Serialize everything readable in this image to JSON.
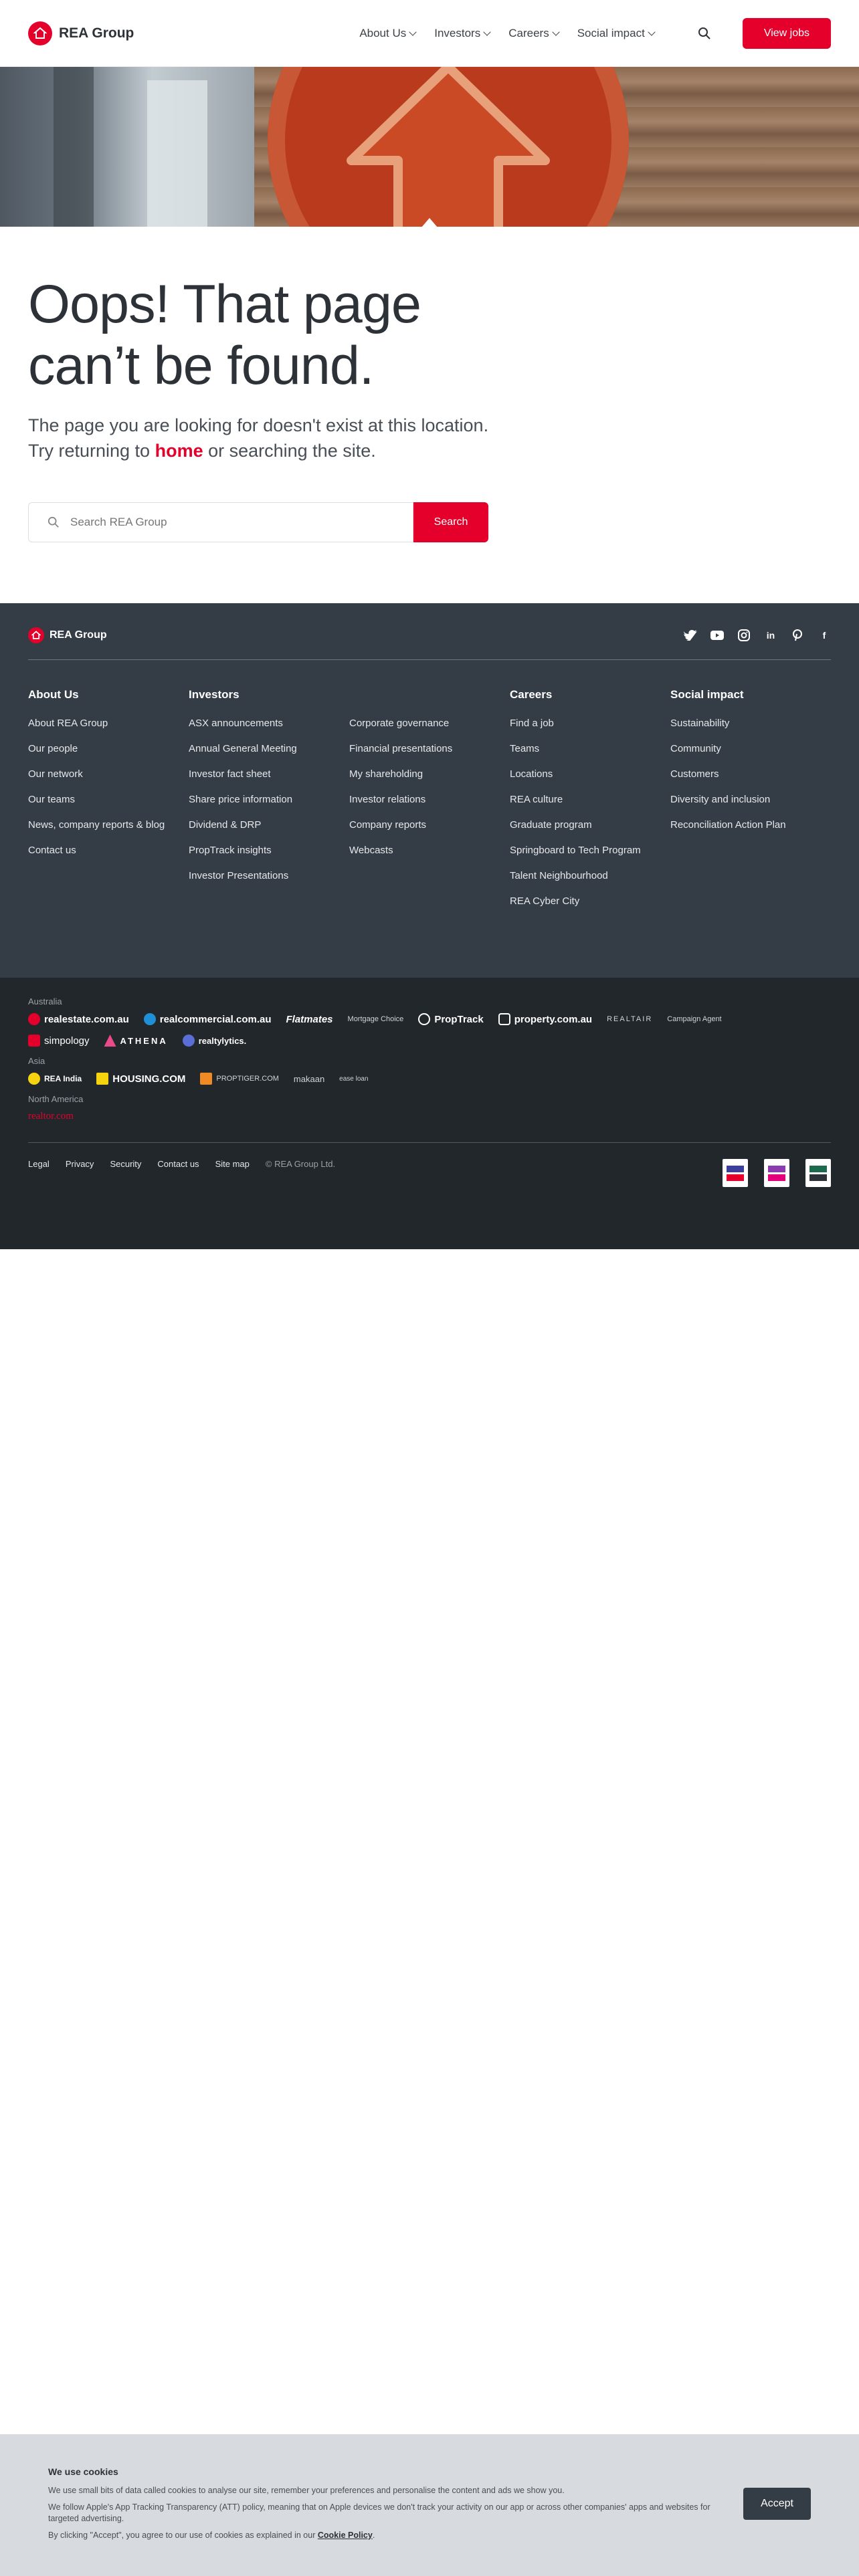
{
  "header": {
    "brand": "REA Group",
    "nav": [
      {
        "label": "About Us"
      },
      {
        "label": "Investors"
      },
      {
        "label": "Careers"
      },
      {
        "label": "Social impact"
      }
    ],
    "cta": "View jobs"
  },
  "main": {
    "title": "Oops! That page can’t be found.",
    "lead_before": "The page you are looking for doesn't exist at this location. Try returning to ",
    "home_link": "home",
    "lead_after": " or searching the site.",
    "search_placeholder": "Search REA Group",
    "search_button": "Search"
  },
  "footer": {
    "brand": "REA Group",
    "socials": [
      "twitter-icon",
      "youtube-icon",
      "instagram-icon",
      "linkedin-icon",
      "pinterest-icon",
      "facebook-icon"
    ],
    "columns": {
      "about": {
        "heading": "About Us",
        "items": [
          "About REA Group",
          "Our people",
          "Our network",
          "Our teams",
          "News, company reports & blog",
          "Contact us"
        ]
      },
      "investors": {
        "heading": "Investors",
        "items": [
          "ASX announcements",
          "Annual General Meeting",
          "Investor fact sheet",
          "Share price information",
          "Dividend & DRP",
          "PropTrack insights",
          "Investor Presentations"
        ]
      },
      "investors2": {
        "heading": "",
        "items": [
          "Corporate governance",
          "Financial presentations",
          "My shareholding",
          "Investor relations",
          "Company reports",
          "Webcasts"
        ]
      },
      "careers": {
        "heading": "Careers",
        "items": [
          "Find a job",
          "Teams",
          "Locations",
          "REA culture",
          "Graduate program",
          "Springboard to Tech Program",
          "Talent Neighbourhood",
          "REA Cyber City"
        ]
      },
      "social": {
        "heading": "Social impact",
        "items": [
          "Sustainability",
          "Community",
          "Customers",
          "Diversity and inclusion",
          "Reconciliation Action Plan"
        ]
      }
    }
  },
  "brands": {
    "australia_label": "Australia",
    "australia": [
      "realestate.com.au",
      "realcommercial.com.au",
      "Flatmates",
      "Mortgage Choice",
      "PropTrack",
      "property.com.au",
      "REALTAIR",
      "Campaign Agent",
      "simpology",
      "ATHENA",
      "realtylytics."
    ],
    "asia_label": "Asia",
    "asia": [
      "REA India",
      "HOUSING.COM",
      "PROPTIGER.COM",
      "makaan",
      "ease loan"
    ],
    "na_label": "North America",
    "na": [
      "realtor.com"
    ]
  },
  "legal": {
    "links": [
      "Legal",
      "Privacy",
      "Security",
      "Contact us",
      "Site map"
    ],
    "copyright": "© REA Group Ltd."
  },
  "cookie": {
    "title": "We use cookies",
    "p1": "We use small bits of data called cookies to analyse our site, remember your preferences and personalise the content and ads we show you.",
    "p2": "We follow Apple's App Tracking Transparency (ATT) policy, meaning that on Apple devices we don't track your activity on our app or across other companies' apps and websites for targeted advertising.",
    "p3_before": "By clicking \"Accept\", you agree to our use of cookies as explained in our ",
    "p3_link": "Cookie Policy",
    "p3_after": ".",
    "accept": "Accept"
  },
  "colors": {
    "accent": "#e4002b",
    "footer_bg": "#343d46",
    "brands_bg": "#22272c",
    "cookie_bg": "#d7dbdf"
  }
}
